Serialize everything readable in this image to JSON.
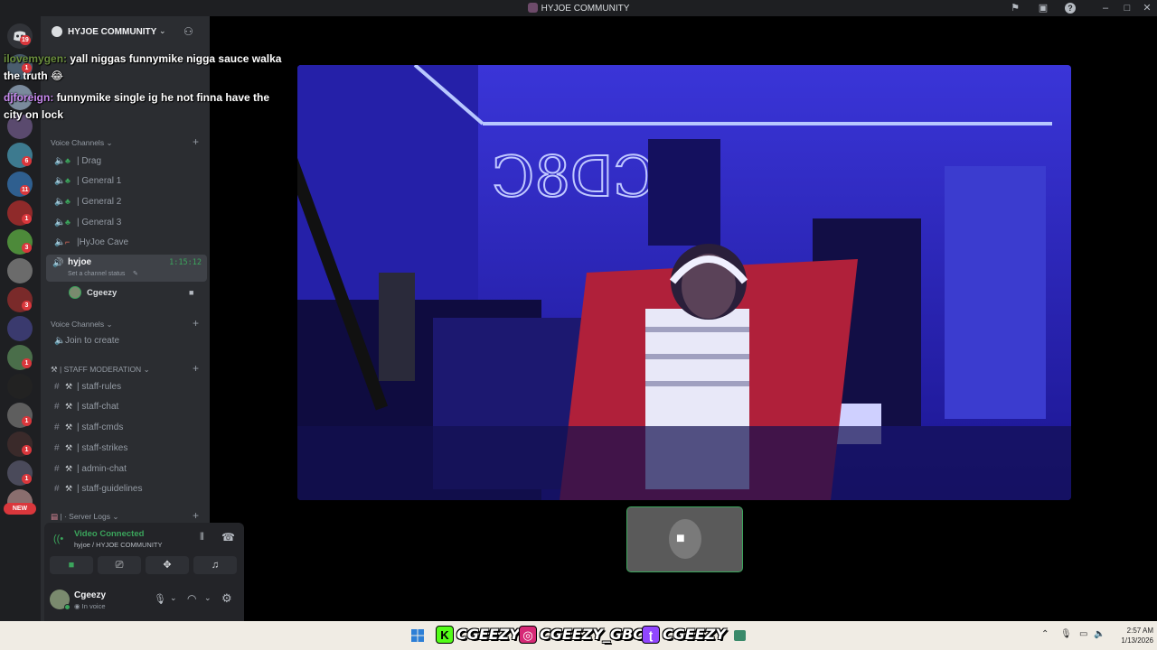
{
  "window": {
    "title": "HYJOE COMMUNITY"
  },
  "rail": {
    "home_badge": "19",
    "new_label": "NEW",
    "badges": [
      "1",
      "6",
      "11",
      "1",
      "3",
      "3",
      "1",
      "1",
      "1",
      "1"
    ]
  },
  "server": {
    "name": "HYJOE COMMUNITY"
  },
  "categories": {
    "voice1": "Voice Channels",
    "voice2": "Voice Channels",
    "staff": "STAFF MODERATION",
    "logs": "Server Logs"
  },
  "voice_channels": [
    {
      "label": "| Drag"
    },
    {
      "label": "| General 1"
    },
    {
      "label": "| General 2"
    },
    {
      "label": "| General 3"
    },
    {
      "label": "|HyJoe Cave"
    }
  ],
  "active_channel": {
    "name": "hyjoe",
    "timer": "1:15:12",
    "status_placeholder": "Set a channel status",
    "member": "Cgeezy"
  },
  "join_to_create": "Join to create",
  "staff_channels": [
    {
      "label": "| staff-rules"
    },
    {
      "label": "|  staff-chat"
    },
    {
      "label": "| staff-cmds"
    },
    {
      "label": "| staff-strikes"
    },
    {
      "label": "| admin-chat"
    },
    {
      "label": "| staff-guidelines"
    }
  ],
  "voice_status": {
    "title": "Video Connected",
    "subtitle": "hyjoe / HYJOE COMMUNITY"
  },
  "user": {
    "name": "Cgeezy",
    "status": "In voice"
  },
  "overlay_chat": [
    {
      "user": "ilovemygen:",
      "text": "yall niggas funnymike nigga sauce walka the truth 😂",
      "user_color": "#6b8f3e"
    },
    {
      "user": "djforeign:",
      "text": "funnymike single ig he not finna have the city on lock",
      "user_color": "#c98af0"
    }
  ],
  "taskbar": {
    "socials": [
      {
        "platform": "kick",
        "handle": "CGEEZY",
        "color": "#53fc18"
      },
      {
        "platform": "instagram",
        "handle": "CGEEZY_GBC",
        "color": "#d62976"
      },
      {
        "platform": "twitch",
        "handle": "CGEEZY",
        "color": "#9146ff"
      }
    ],
    "time": "2:57 AM",
    "date": "1/13/2026"
  },
  "colors": {
    "accent_green": "#3ba55c",
    "badge_red": "#da373c",
    "sidebar_bg": "#2b2d31",
    "rail_bg": "#1e1f22"
  }
}
